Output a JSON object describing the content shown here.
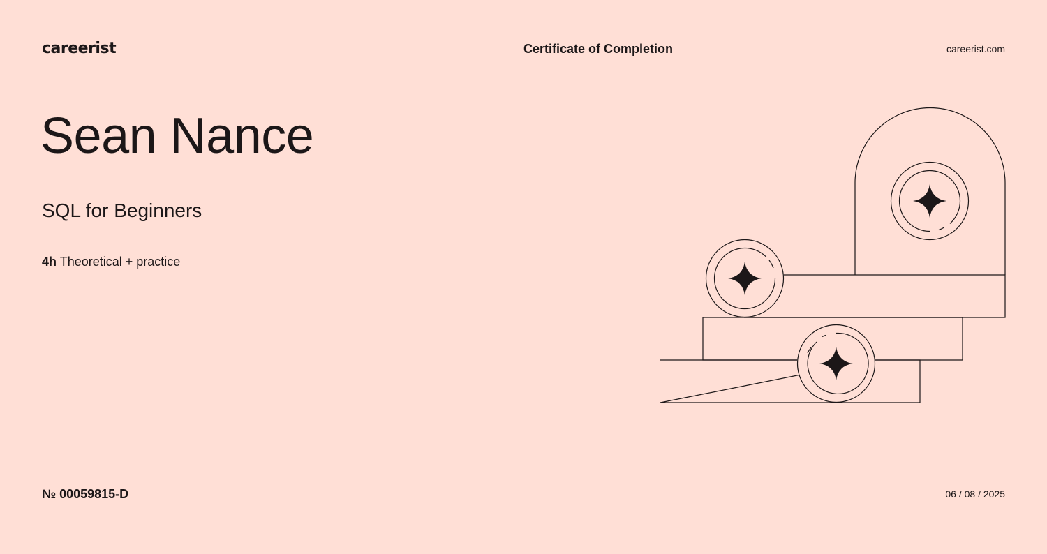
{
  "header": {
    "logo": "careerist",
    "title": "Certificate of Completion",
    "site": "careerist.com"
  },
  "certificate": {
    "recipient": "Sean Nance",
    "course": "SQL for Beginners",
    "hours": "4h",
    "format": "Theoretical + practice",
    "number": "№ 00059815-D",
    "date": "06 / 08 / 2025"
  },
  "colors": {
    "background": "#ffdfd6",
    "ink": "#1c1718"
  },
  "illustration": {
    "icon": "sparkle-coin-stack-icon"
  }
}
